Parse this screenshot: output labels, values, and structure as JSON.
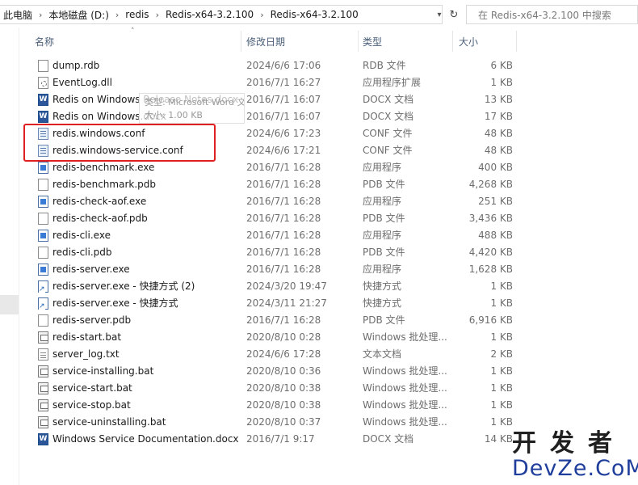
{
  "address_bar": {
    "crumbs": [
      "此电脑",
      "本地磁盘 (D:)",
      "redis",
      "Redis-x64-3.2.100",
      "Redis-x64-3.2.100"
    ],
    "separator": "›"
  },
  "search": {
    "placeholder": "在 Redis-x64-3.2.100 中搜索"
  },
  "columns": {
    "name": "名称",
    "date": "修改日期",
    "type": "类型",
    "size": "大小"
  },
  "files": [
    {
      "name": "dump.rdb",
      "date": "2024/6/6 17:06",
      "type": "RDB 文件",
      "size": "6 KB",
      "icon": "file-icon"
    },
    {
      "name": "EventLog.dll",
      "date": "2016/7/1 16:27",
      "type": "应用程序扩展",
      "size": "1 KB",
      "icon": "dll-icon"
    },
    {
      "name": "Redis on Windows Release Notes.docx",
      "date": "2016/7/1 16:07",
      "type": "DOCX 文档",
      "size": "13 KB",
      "icon": "word-icon"
    },
    {
      "name": "Redis on Windows.docx",
      "date": "2016/7/1 16:07",
      "type": "DOCX 文档",
      "size": "17 KB",
      "icon": "word-icon"
    },
    {
      "name": "redis.windows.conf",
      "date": "2024/6/6 17:23",
      "type": "CONF 文件",
      "size": "48 KB",
      "icon": "conf-icon"
    },
    {
      "name": "redis.windows-service.conf",
      "date": "2024/6/6 17:21",
      "type": "CONF 文件",
      "size": "48 KB",
      "icon": "conf-icon"
    },
    {
      "name": "redis-benchmark.exe",
      "date": "2016/7/1 16:28",
      "type": "应用程序",
      "size": "400 KB",
      "icon": "exe-icon"
    },
    {
      "name": "redis-benchmark.pdb",
      "date": "2016/7/1 16:28",
      "type": "PDB 文件",
      "size": "4,268 KB",
      "icon": "file-icon"
    },
    {
      "name": "redis-check-aof.exe",
      "date": "2016/7/1 16:28",
      "type": "应用程序",
      "size": "251 KB",
      "icon": "exe-icon"
    },
    {
      "name": "redis-check-aof.pdb",
      "date": "2016/7/1 16:28",
      "type": "PDB 文件",
      "size": "3,436 KB",
      "icon": "file-icon"
    },
    {
      "name": "redis-cli.exe",
      "date": "2016/7/1 16:28",
      "type": "应用程序",
      "size": "488 KB",
      "icon": "exe-icon"
    },
    {
      "name": "redis-cli.pdb",
      "date": "2016/7/1 16:28",
      "type": "PDB 文件",
      "size": "4,420 KB",
      "icon": "file-icon"
    },
    {
      "name": "redis-server.exe",
      "date": "2016/7/1 16:28",
      "type": "应用程序",
      "size": "1,628 KB",
      "icon": "exe-icon"
    },
    {
      "name": "redis-server.exe - 快捷方式 (2)",
      "date": "2024/3/20 19:47",
      "type": "快捷方式",
      "size": "1 KB",
      "icon": "shortcut-icon"
    },
    {
      "name": "redis-server.exe - 快捷方式",
      "date": "2024/3/11 21:27",
      "type": "快捷方式",
      "size": "1 KB",
      "icon": "shortcut-icon"
    },
    {
      "name": "redis-server.pdb",
      "date": "2016/7/1 16:28",
      "type": "PDB 文件",
      "size": "6,916 KB",
      "icon": "file-icon"
    },
    {
      "name": "redis-start.bat",
      "date": "2020/8/10 0:28",
      "type": "Windows 批处理...",
      "size": "1 KB",
      "icon": "batch-icon"
    },
    {
      "name": "server_log.txt",
      "date": "2024/6/6 17:28",
      "type": "文本文档",
      "size": "2 KB",
      "icon": "text-icon"
    },
    {
      "name": "service-installing.bat",
      "date": "2020/8/10 0:36",
      "type": "Windows 批处理...",
      "size": "1 KB",
      "icon": "batch-icon"
    },
    {
      "name": "service-start.bat",
      "date": "2020/8/10 0:38",
      "type": "Windows 批处理...",
      "size": "1 KB",
      "icon": "batch-icon"
    },
    {
      "name": "service-stop.bat",
      "date": "2020/8/10 0:38",
      "type": "Windows 批处理...",
      "size": "1 KB",
      "icon": "batch-icon"
    },
    {
      "name": "service-uninstalling.bat",
      "date": "2020/8/10 0:37",
      "type": "Windows 批处理...",
      "size": "1 KB",
      "icon": "batch-icon"
    },
    {
      "name": "Windows Service Documentation.docx",
      "date": "2016/7/1 9:17",
      "type": "DOCX 文档",
      "size": "14 KB",
      "icon": "word-icon"
    }
  ],
  "tooltip": {
    "line1": "类型: Microsoft Word 文档",
    "line2": "大小: 1.00 KB"
  },
  "watermark": {
    "cn": "开发者",
    "en": "DevZe.CoM"
  },
  "colors": {
    "highlight": "#e02020",
    "header_text": "#4c607a",
    "watermark_blue": "#1f3e9c"
  }
}
